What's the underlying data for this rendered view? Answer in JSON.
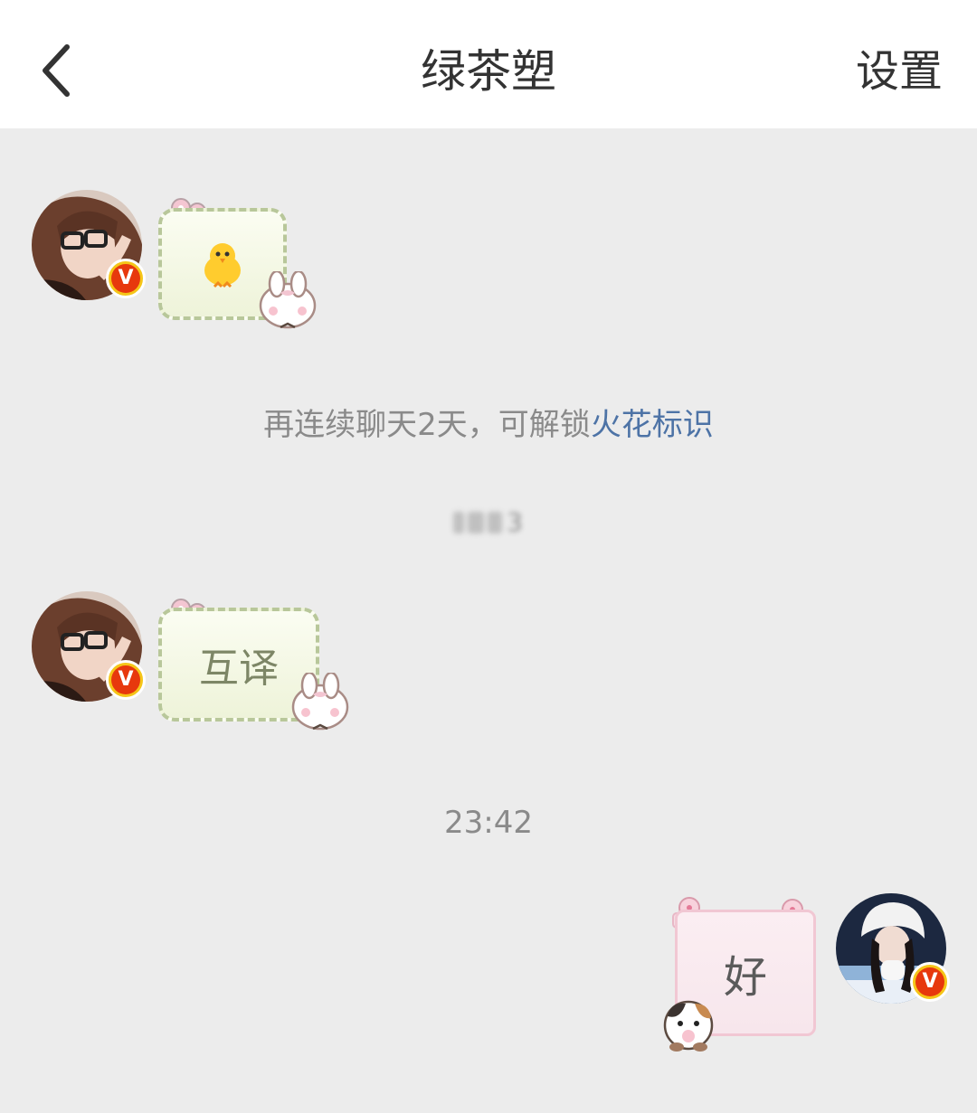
{
  "header": {
    "title": "绿茶塑",
    "settings_label": "设置"
  },
  "messages": [
    {
      "side": "left",
      "type": "emoji",
      "content": "🐥"
    },
    {
      "side": "left",
      "type": "text",
      "content": "互译"
    },
    {
      "side": "right",
      "type": "text",
      "content": "好"
    }
  ],
  "system": {
    "streak_text": "再连续聊天2天，可解锁",
    "streak_link": "火花标识",
    "timestamp_blurred": "3",
    "timestamp": "23:42"
  },
  "badge_label": "V",
  "colors": {
    "header_bg": "#ffffff",
    "chat_bg": "#ececec",
    "link": "#4d73a6",
    "badge_gold": "#f5c518",
    "badge_red": "#e7380d"
  }
}
